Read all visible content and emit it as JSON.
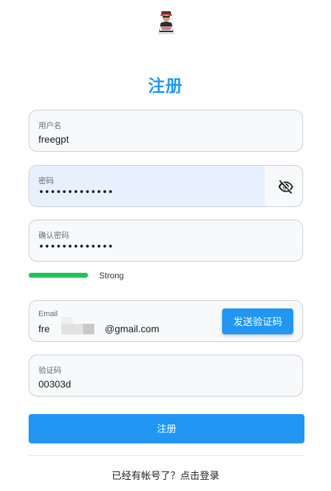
{
  "title": "注册",
  "username": {
    "label": "用户名",
    "value": "freegpt"
  },
  "password": {
    "label": "密码",
    "value": "•••••••••••••",
    "toggle_icon": "eye-off-icon"
  },
  "confirm_password": {
    "label": "确认密码",
    "value": "•••••••••••••"
  },
  "strength": {
    "text": "Strong",
    "color": "#1fc35a"
  },
  "email": {
    "label": "Email",
    "value_prefix": "fre",
    "value_suffix": "@gmail.com",
    "send_code_button": "发送验证码"
  },
  "verification_code": {
    "label": "验证码",
    "value": "00303d"
  },
  "submit_button": "注册",
  "login_link": "已经有帐号了？点击登录",
  "colors": {
    "accent": "#2196f3",
    "autofill": "#e8f0fe"
  }
}
